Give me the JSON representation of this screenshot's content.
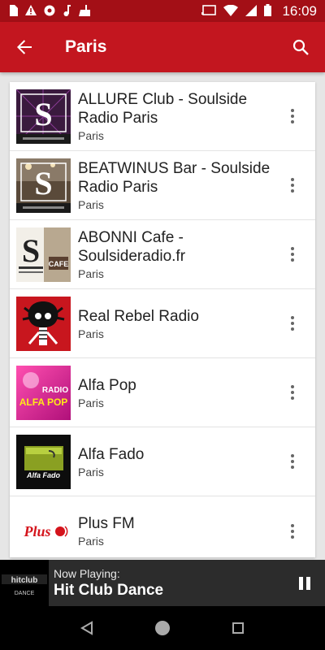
{
  "status_bar": {
    "time": "16:09",
    "left_icons": [
      "sim-icon",
      "alert-icon",
      "aperture-icon",
      "music-note-icon",
      "cleaner-icon"
    ],
    "right_icons": [
      "cast-icon",
      "wifi-icon",
      "signal-icon",
      "battery-icon"
    ]
  },
  "app_bar": {
    "title": "Paris",
    "back_icon": "arrow-back-icon",
    "search_icon": "search-icon"
  },
  "stations": [
    {
      "title": "ALLURE Club - Soulside Radio Paris",
      "city": "Paris",
      "logo": "soulside-club-logo"
    },
    {
      "title": "BEATWINUS Bar - Soulside Radio Paris",
      "city": "Paris",
      "logo": "soulside-bar-logo"
    },
    {
      "title": "ABONNI Cafe - Soulsideradio.fr",
      "city": "Paris",
      "logo": "soulside-cafe-logo"
    },
    {
      "title": "Real Rebel Radio",
      "city": "Paris",
      "logo": "skeleton-logo"
    },
    {
      "title": "Alfa Pop",
      "city": "Paris",
      "logo": "radio-alfa-pop-logo",
      "logo_text_1": "RADIO",
      "logo_text_2": "ALFA POP"
    },
    {
      "title": "Alfa Fado",
      "city": "Paris",
      "logo": "alfa-fado-logo",
      "logo_text_1": "Alfa Fado"
    },
    {
      "title": "Plus FM",
      "city": "Paris",
      "logo": "plus-fm-logo",
      "logo_text_1": "Plus"
    }
  ],
  "now_playing": {
    "label": "Now Playing:",
    "title": "Hit Club Dance",
    "logo_text": "hitclub",
    "logo_subtext": "DANCE"
  },
  "colors": {
    "status_bar": "#a30f16",
    "app_bar": "#c3161f",
    "now_playing_bar": "#2c2c2c",
    "nav_bar": "#000000"
  }
}
